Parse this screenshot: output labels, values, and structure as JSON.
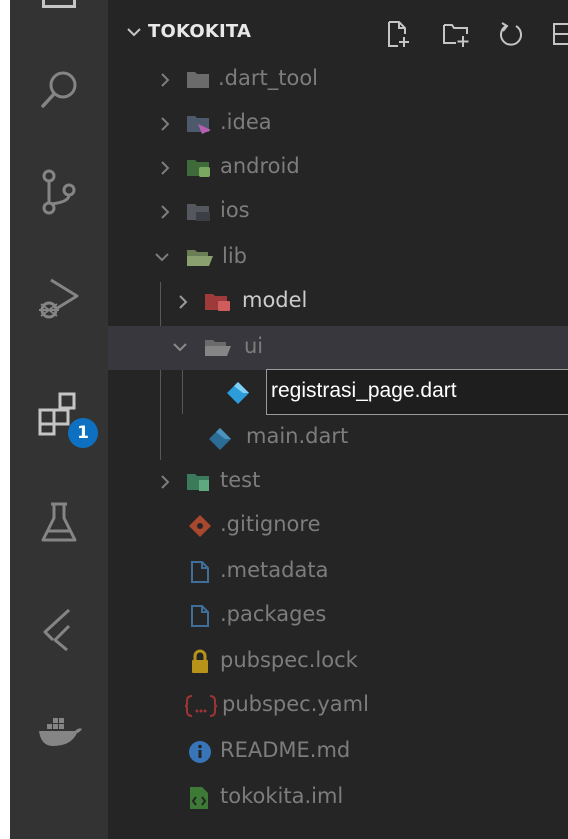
{
  "explorer": {
    "section_title": "TOKOKITA",
    "actions": [
      "new-file-icon",
      "new-folder-icon",
      "refresh-icon",
      "collapse-all-icon"
    ]
  },
  "activity_bar": {
    "items": [
      "search-icon",
      "source-control-icon",
      "run-debug-icon",
      "extensions-icon",
      "testing-icon",
      "flutter-icon",
      "docker-icon"
    ],
    "extensions_badge": "1"
  },
  "tree": {
    "dart_tool": ".dart_tool",
    "idea": ".idea",
    "android": "android",
    "ios": "ios",
    "lib": "lib",
    "model": "model",
    "ui": "ui",
    "rename_value": "registrasi_page.dart",
    "main": "main.dart",
    "test": "test",
    "gitignore": ".gitignore",
    "metadata": ".metadata",
    "packages": ".packages",
    "pubspec_lock": "pubspec.lock",
    "pubspec_yaml": "pubspec.yaml",
    "readme": "README.md",
    "iml": "tokokita.iml"
  },
  "colors": {
    "activity_bg": "#333333",
    "sidebar_bg": "#252526",
    "dart_blue": "#2d9cdb",
    "badge_blue": "#0e70c0"
  }
}
